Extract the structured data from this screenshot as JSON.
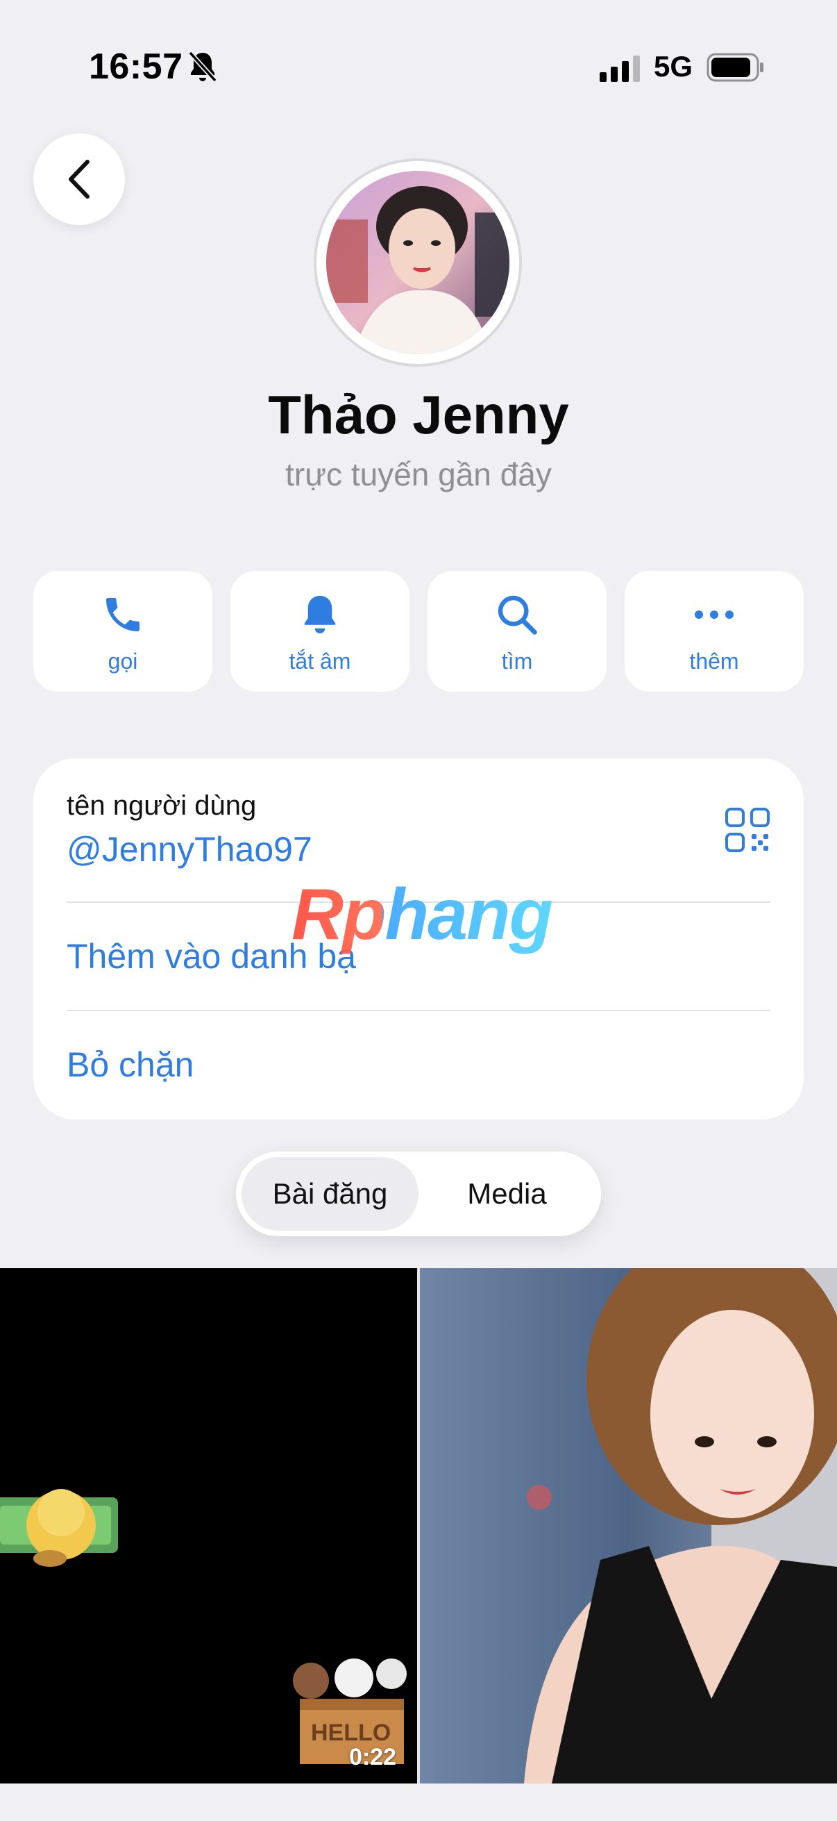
{
  "status_bar": {
    "time": "16:57",
    "network": "5G"
  },
  "profile": {
    "name": "Thảo Jenny",
    "status": "trực tuyến gần đây"
  },
  "actions": [
    {
      "label": "gọi",
      "icon": "phone-icon"
    },
    {
      "label": "tắt âm",
      "icon": "bell-icon"
    },
    {
      "label": "tìm",
      "icon": "search-icon"
    },
    {
      "label": "thêm",
      "icon": "more-icon"
    }
  ],
  "info": {
    "username_caption": "tên người dùng",
    "username": "@JennyThao97",
    "add_contact": "Thêm vào danh bạ",
    "unblock": "Bỏ chặn"
  },
  "watermark": "Rphang",
  "tabs": [
    {
      "label": "Bài đăng",
      "active": true
    },
    {
      "label": "Media",
      "active": false
    }
  ],
  "media": [
    {
      "type": "video",
      "duration": "0:22",
      "sticker_text": "HELLO"
    },
    {
      "type": "photo"
    }
  ],
  "colors": {
    "accent": "#2f7de1",
    "background": "#efeff4",
    "card": "#ffffff",
    "secondary_text": "#8e8e93"
  }
}
